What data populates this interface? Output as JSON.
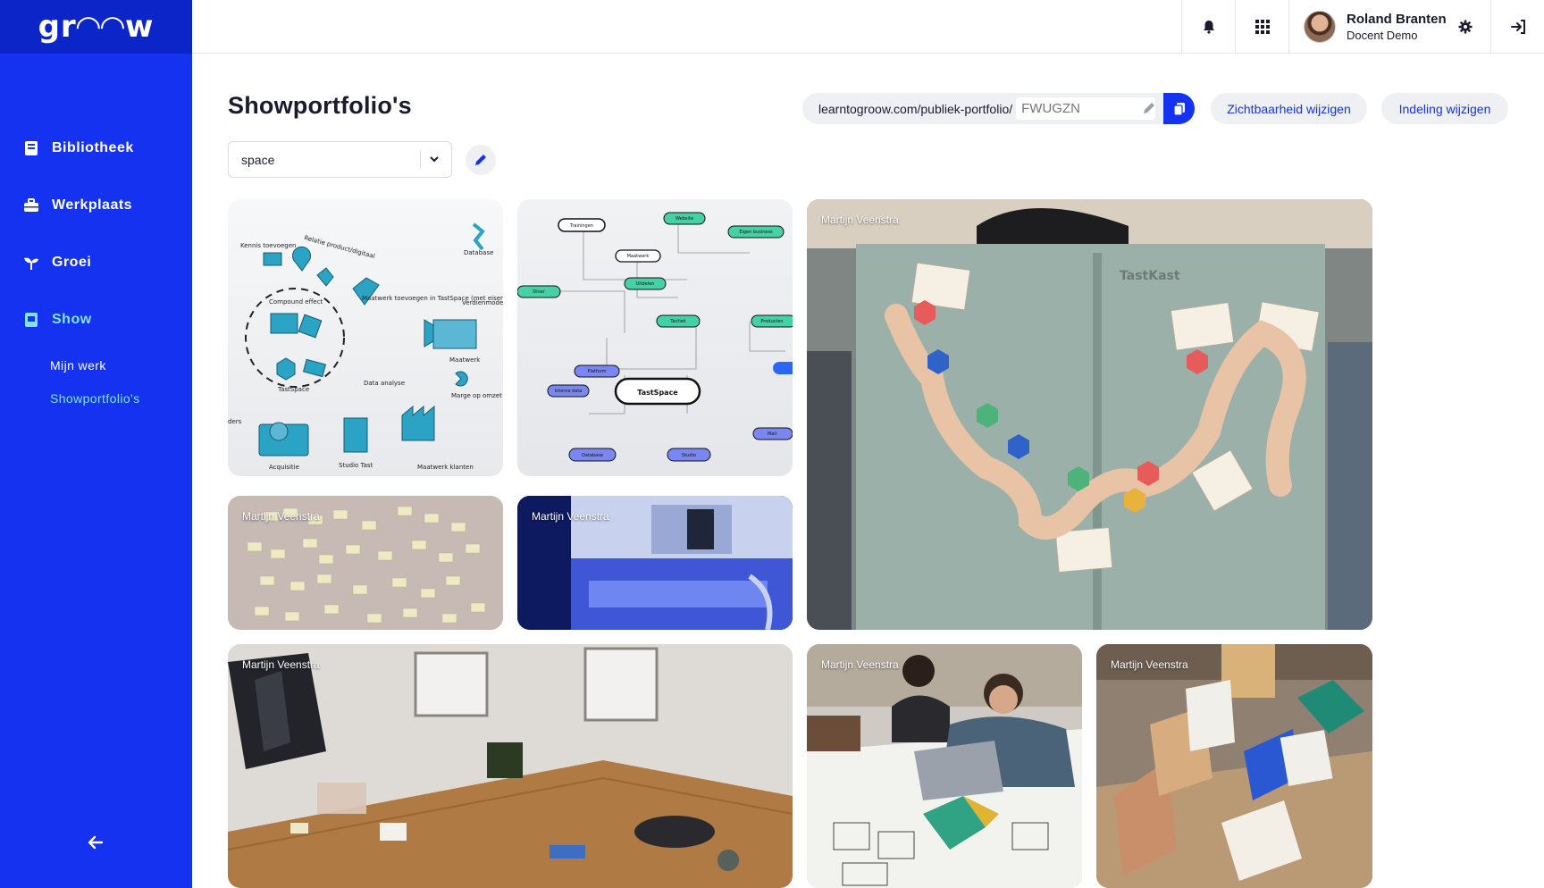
{
  "app": {
    "logo": "gr◠◠w"
  },
  "sidebar": {
    "items": [
      {
        "label": "Bibliotheek",
        "icon": "book-icon"
      },
      {
        "label": "Werkplaats",
        "icon": "toolbox-icon"
      },
      {
        "label": "Groei",
        "icon": "sprout-icon"
      },
      {
        "label": "Show",
        "icon": "show-icon"
      }
    ],
    "subitems": [
      {
        "label": "Mijn werk"
      },
      {
        "label": "Showportfolio's"
      }
    ]
  },
  "topbar": {
    "user_name": "Roland Branten",
    "user_role": "Docent Demo"
  },
  "page": {
    "title": "Showportfolio's",
    "url_prefix": "learntogroow.com/publiek-portfolio/",
    "url_placeholder": "FWUGZN",
    "visibility_button": "Zichtbaarheid wijzigen",
    "layout_button": "Indeling wijzigen",
    "select_value": "space"
  },
  "tiles": [
    {
      "id": "diagram-compound",
      "author": ""
    },
    {
      "id": "diagram-tastspace",
      "author": ""
    },
    {
      "id": "photo-tastkast",
      "author": "Martijn Veenstra"
    },
    {
      "id": "photo-postits",
      "author": "Martijn Veenstra"
    },
    {
      "id": "photo-printer",
      "author": "Martijn Veenstra"
    },
    {
      "id": "photo-table",
      "author": "Martijn Veenstra"
    },
    {
      "id": "photo-student",
      "author": "Martijn Veenstra"
    },
    {
      "id": "photo-blocks",
      "author": "Martijn Veenstra"
    }
  ],
  "diagram1": {
    "labels": [
      "Kennis toevoegen",
      "Relatie product/digitaal",
      "Database",
      "Compound effect",
      "Maatwerk toevoegen in TastSpace (met eisen)",
      "Verdienmodel",
      "Maatwerk",
      "Data analyse",
      "Marge op omzet",
      "TastSpace",
      "Acquisitie",
      "Studio Tast",
      "Maatwerk klanten",
      "ders"
    ]
  },
  "diagram2": {
    "nodes": [
      "Trainingen",
      "Website",
      "Eigen business",
      "Maatwerk",
      "Uitdelen",
      "Diner",
      "Tactiek",
      "Producten",
      "Platform",
      "Interne data",
      "TastSpace",
      "Mail",
      "Database",
      "Studio"
    ]
  },
  "photo_texts": {
    "tastkast_label": "TastKast"
  },
  "colors": {
    "brand": "#1432f0",
    "brand_dark": "#0c25c9",
    "accent": "#7fe3f2"
  }
}
